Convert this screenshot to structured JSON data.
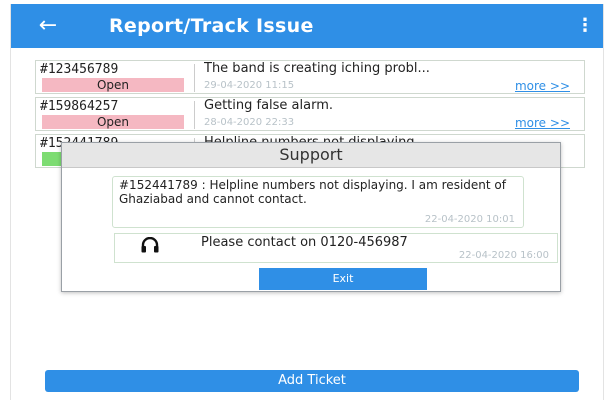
{
  "appbar": {
    "back_icon": "arrow-left-icon",
    "title": "Report/Track Issue",
    "menu_icon": "more-vertical-icon"
  },
  "tickets": [
    {
      "id": "#123456789",
      "status": "Open",
      "summary": "The band is creating iching probl...",
      "date": "29-04-2020 11:15",
      "more": "more >>"
    },
    {
      "id": "#159864257",
      "status": "Open",
      "summary": "Getting false alarm.",
      "date": "28-04-2020 22:33",
      "more": "more >>"
    },
    {
      "id": "#152441789",
      "status": "",
      "summary": "Helpline numbers not displaying",
      "date": "",
      "more": ""
    }
  ],
  "dialog": {
    "title": "Support",
    "message": "#152441789 : Helpline numbers not displaying. I am resident of Ghaziabad and cannot contact.",
    "message_date": "22-04-2020 10:01",
    "reply_icon": "headset-icon",
    "reply": "Please contact on 0120-456987",
    "reply_date": "22-04-2020 16:00",
    "exit_label": "Exit"
  },
  "add_ticket_label": "Add Ticket",
  "colors": {
    "primary": "#2f8fe6",
    "status_open": "#f5b8c2",
    "status_resolved": "#7ddc72"
  }
}
